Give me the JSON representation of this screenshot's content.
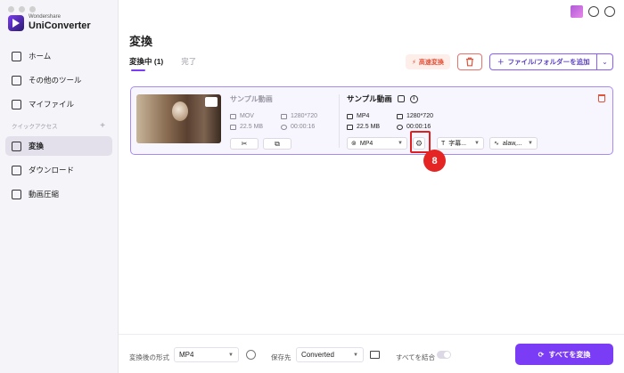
{
  "brand": {
    "small": "Wondershare",
    "big": "UniConverter"
  },
  "sidebar": {
    "items": [
      {
        "label": "ホーム",
        "icon": "home-icon"
      },
      {
        "label": "その他のツール",
        "icon": "toolbox-icon"
      },
      {
        "label": "マイファイル",
        "icon": "file-icon"
      }
    ],
    "section": "クイックアクセス",
    "section_add": "+",
    "quick": [
      {
        "label": "変換",
        "icon": "convert-icon",
        "active": true
      },
      {
        "label": "ダウンロード",
        "icon": "download-icon"
      },
      {
        "label": "動画圧縮",
        "icon": "compress-icon"
      }
    ]
  },
  "main": {
    "title": "変換",
    "tabs": [
      {
        "label": "変換中 (1)"
      },
      {
        "label": "完了"
      }
    ],
    "fast_convert": "高速変換",
    "add_files": "ファイル/フォルダーを追加"
  },
  "file": {
    "source": {
      "name": "サンプル動画",
      "format": "MOV",
      "resolution": "1280*720",
      "size": "22.5 MB",
      "duration": "00:00:16"
    },
    "target": {
      "name": "サンプル動画",
      "format": "MP4",
      "resolution": "1280*720",
      "size": "22.5 MB",
      "duration": "00:00:16"
    },
    "output_format": "MP4",
    "subtitle": "字幕...",
    "audio": "alaw,..."
  },
  "annotation": {
    "step": "8"
  },
  "footer": {
    "format_label": "変換後の形式",
    "format_value": "MP4",
    "save_label": "保存先",
    "save_value": "Converted",
    "merge_label": "すべてを結合",
    "convert_all": "すべてを変換"
  },
  "colors": {
    "accent": "#7a3cf5",
    "danger": "#e2533a",
    "highlight": "#e02020"
  }
}
